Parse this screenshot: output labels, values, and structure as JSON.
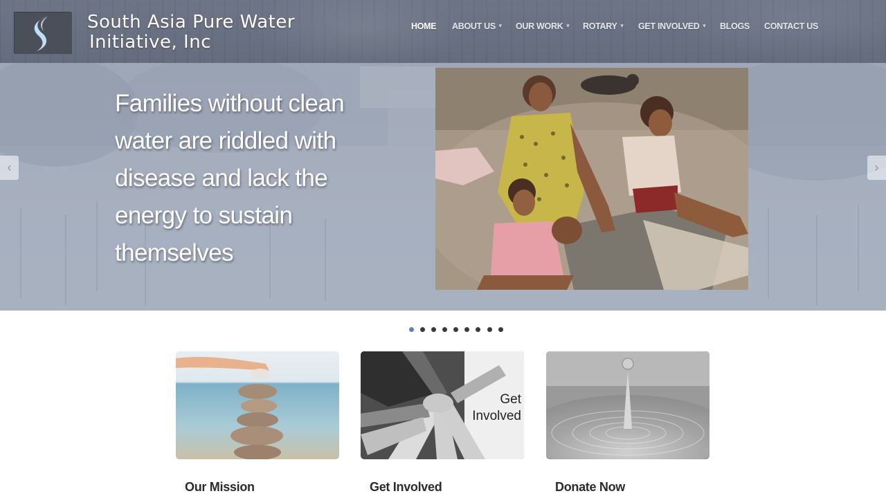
{
  "site": {
    "logo_line1": "South Asia Pure Water",
    "logo_line2": "Initiative, Inc",
    "logo_icon": "s-wave-logo-icon"
  },
  "nav": {
    "items": [
      {
        "label": "HOME",
        "active": true,
        "dropdown": false
      },
      {
        "label": "ABOUT US",
        "active": false,
        "dropdown": true
      },
      {
        "label": "OUR WORK",
        "active": false,
        "dropdown": true
      },
      {
        "label": "ROTARY",
        "active": false,
        "dropdown": true
      },
      {
        "label": "GET INVOLVED",
        "active": false,
        "dropdown": true
      },
      {
        "label": "BLOGS",
        "active": false,
        "dropdown": false
      },
      {
        "label": "CONTACT US",
        "active": false,
        "dropdown": false
      }
    ]
  },
  "hero": {
    "headline": "Families without clean water are riddled with disease and lack the energy to sustain themselves",
    "prev_icon": "chevron-left-icon",
    "next_icon": "chevron-right-icon",
    "prev_glyph": "‹",
    "next_glyph": "›"
  },
  "slider": {
    "slide_count": 9,
    "active_index": 0
  },
  "cards": [
    {
      "title": "Our Mission",
      "image": "stacked-stones-beach-photo",
      "overlay_line1": "",
      "overlay_line2": ""
    },
    {
      "title": "Get Involved",
      "image": "hands-together-photo",
      "overlay_line1": "Get",
      "overlay_line2": "Involved"
    },
    {
      "title": "Donate Now",
      "image": "water-drop-photo",
      "overlay_line1": "",
      "overlay_line2": ""
    }
  ],
  "colors": {
    "header_bg": "#6a7283",
    "hero_bg": "#a4adbd",
    "active_dot": "#5b7fc0",
    "dot": "#3a3a3a"
  }
}
